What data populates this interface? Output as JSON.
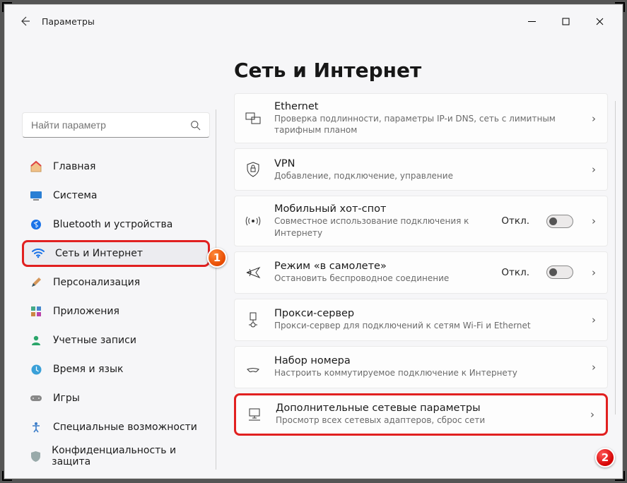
{
  "app_title": "Параметры",
  "search": {
    "placeholder": "Найти параметр"
  },
  "sidebar": {
    "items": [
      {
        "label": "Главная"
      },
      {
        "label": "Система"
      },
      {
        "label": "Bluetooth и устройства"
      },
      {
        "label": "Сеть и Интернет"
      },
      {
        "label": "Персонализация"
      },
      {
        "label": "Приложения"
      },
      {
        "label": "Учетные записи"
      },
      {
        "label": "Время и язык"
      },
      {
        "label": "Игры"
      },
      {
        "label": "Специальные возможности"
      },
      {
        "label": "Конфиденциальность и защита"
      }
    ]
  },
  "page_title": "Сеть и Интернет",
  "cards": [
    {
      "title": "Ethernet",
      "desc": "Проверка подлинности, параметры IP-и DNS, сеть с лимитным тарифным планом"
    },
    {
      "title": "VPN",
      "desc": "Добавление, подключение, управление"
    },
    {
      "title": "Мобильный хот-спот",
      "desc": "Совместное использование подключения к Интернету",
      "status": "Откл."
    },
    {
      "title": "Режим «в самолете»",
      "desc": "Остановить беспроводное соединение",
      "status": "Откл."
    },
    {
      "title": "Прокси-сервер",
      "desc": "Прокси-сервер для подключений к сетям Wi-Fi и Ethernet"
    },
    {
      "title": "Набор номера",
      "desc": "Настроить коммутируемое подключение к Интернету"
    },
    {
      "title": "Дополнительные сетевые параметры",
      "desc": "Просмотр всех сетевых адаптеров, сброс сети"
    }
  ],
  "badges": {
    "one": "1",
    "two": "2"
  }
}
